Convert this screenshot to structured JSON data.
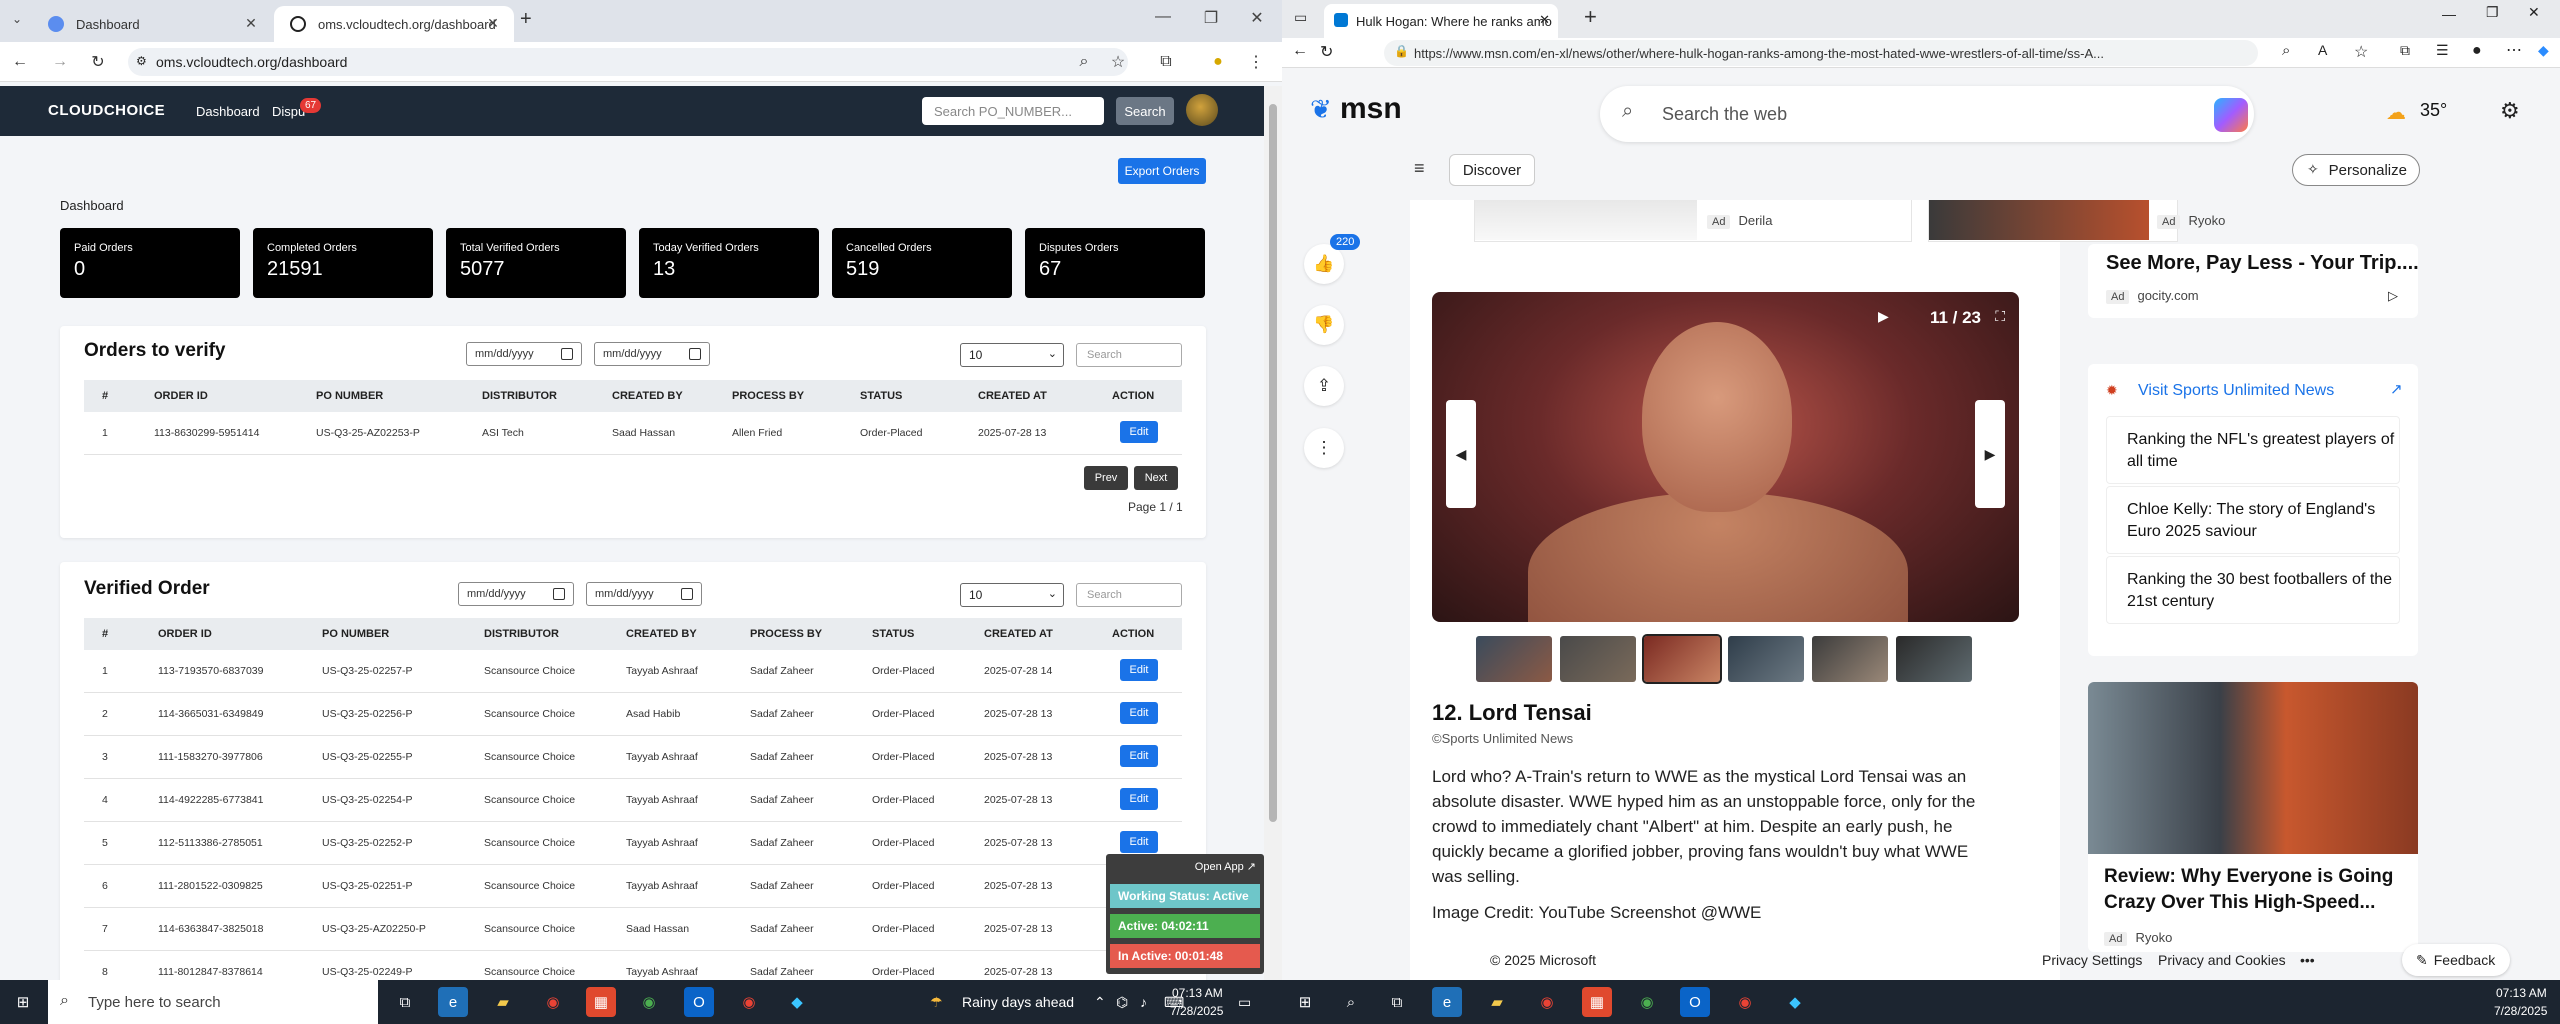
{
  "left_browser": {
    "tabs": [
      {
        "title": "Dashboard"
      },
      {
        "title": "oms.vcloudtech.org/dashboard"
      }
    ],
    "new_tab": "+",
    "url": "oms.vcloudtech.org/dashboard"
  },
  "app": {
    "logo": "CLOUDCHOICE",
    "nav": {
      "dashboard": "Dashboard",
      "disputes": "Dispu",
      "disputes_badge": "67"
    },
    "search_placeholder": "Search PO_NUMBER...",
    "search_button": "Search",
    "export_button": "Export Orders",
    "section": "Dashboard",
    "stats": [
      {
        "label": "Paid Orders",
        "value": "0"
      },
      {
        "label": "Completed Orders",
        "value": "21591"
      },
      {
        "label": "Total Verified Orders",
        "value": "5077"
      },
      {
        "label": "Today Verified Orders",
        "value": "13"
      },
      {
        "label": "Cancelled Orders",
        "value": "519"
      },
      {
        "label": "Disputes Orders",
        "value": "67"
      }
    ],
    "orders_to_verify": {
      "title": "Orders to verify",
      "date_from": "mm/dd/yyyy",
      "date_to": "mm/dd/yyyy",
      "page_size": "10",
      "search_placeholder": "Search",
      "headers": [
        "#",
        "ORDER ID",
        "PO NUMBER",
        "DISTRIBUTOR",
        "CREATED BY",
        "PROCESS BY",
        "STATUS",
        "CREATED AT",
        "ACTION"
      ],
      "rows": [
        {
          "n": "1",
          "order_id": "113-8630299-5951414",
          "po": "US-Q3-25-AZ02253-P",
          "distributor": "ASI Tech",
          "created_by": "Saad Hassan",
          "process_by": "Allen Fried",
          "status": "Order-Placed",
          "created_at": "2025-07-28 13",
          "action": "Edit"
        }
      ],
      "prev": "Prev",
      "next": "Next",
      "page_info": "Page 1 / 1"
    },
    "verified_order": {
      "title": "Verified Order",
      "date_from": "mm/dd/yyyy",
      "date_to": "mm/dd/yyyy",
      "page_size": "10",
      "search_placeholder": "Search",
      "headers": [
        "#",
        "ORDER ID",
        "PO NUMBER",
        "DISTRIBUTOR",
        "CREATED BY",
        "PROCESS BY",
        "STATUS",
        "CREATED AT",
        "ACTION"
      ],
      "rows": [
        {
          "n": "1",
          "order_id": "113-7193570-6837039",
          "po": "US-Q3-25-02257-P",
          "distributor": "Scansource Choice",
          "created_by": "Tayyab Ashraaf",
          "process_by": "Sadaf Zaheer",
          "status": "Order-Placed",
          "created_at": "2025-07-28 14",
          "action": "Edit"
        },
        {
          "n": "2",
          "order_id": "114-3665031-6349849",
          "po": "US-Q3-25-02256-P",
          "distributor": "Scansource Choice",
          "created_by": "Asad Habib",
          "process_by": "Sadaf Zaheer",
          "status": "Order-Placed",
          "created_at": "2025-07-28 13",
          "action": "Edit"
        },
        {
          "n": "3",
          "order_id": "111-1583270-3977806",
          "po": "US-Q3-25-02255-P",
          "distributor": "Scansource Choice",
          "created_by": "Tayyab Ashraaf",
          "process_by": "Sadaf Zaheer",
          "status": "Order-Placed",
          "created_at": "2025-07-28 13",
          "action": "Edit"
        },
        {
          "n": "4",
          "order_id": "114-4922285-6773841",
          "po": "US-Q3-25-02254-P",
          "distributor": "Scansource Choice",
          "created_by": "Tayyab Ashraaf",
          "process_by": "Sadaf Zaheer",
          "status": "Order-Placed",
          "created_at": "2025-07-28 13",
          "action": "Edit"
        },
        {
          "n": "5",
          "order_id": "112-5113386-2785051",
          "po": "US-Q3-25-02252-P",
          "distributor": "Scansource Choice",
          "created_by": "Tayyab Ashraaf",
          "process_by": "Sadaf Zaheer",
          "status": "Order-Placed",
          "created_at": "2025-07-28 13",
          "action": "Edit"
        },
        {
          "n": "6",
          "order_id": "111-2801522-0309825",
          "po": "US-Q3-25-02251-P",
          "distributor": "Scansource Choice",
          "created_by": "Tayyab Ashraaf",
          "process_by": "Sadaf Zaheer",
          "status": "Order-Placed",
          "created_at": "2025-07-28 13",
          "action": ""
        },
        {
          "n": "7",
          "order_id": "114-6363847-3825018",
          "po": "US-Q3-25-AZ02250-P",
          "distributor": "Scansource Choice",
          "created_by": "Saad Hassan",
          "process_by": "Sadaf Zaheer",
          "status": "Order-Placed",
          "created_at": "2025-07-28 13",
          "action": ""
        },
        {
          "n": "8",
          "order_id": "111-8012847-8378614",
          "po": "US-Q3-25-02249-P",
          "distributor": "Scansource Choice",
          "created_by": "Tayyab Ashraaf",
          "process_by": "Sadaf Zaheer",
          "status": "Order-Placed",
          "created_at": "2025-07-28 13",
          "action": ""
        }
      ]
    },
    "widget": {
      "open_app": "Open App ↗",
      "working_status": "Working Status: Active",
      "active": "Active: 04:02:11",
      "inactive": "In Active: 00:01:48"
    }
  },
  "right_browser": {
    "tab_title": "Hulk Hogan: Where he ranks amo",
    "new_tab": "+",
    "url": "https://www.msn.com/en-xl/news/other/where-hulk-hogan-ranks-among-the-most-hated-wwe-wrestlers-of-all-time/ss-A...",
    "msn_logo": "msn",
    "search_placeholder": "Search the web",
    "temperature": "35°",
    "discover": "Discover",
    "personalize": "Personalize",
    "top_ads": [
      {
        "tag": "Ad",
        "source": "Derila"
      },
      {
        "tag": "Ad",
        "source": "Ryoko"
      }
    ],
    "likes_count": "220",
    "slide_counter": "11 / 23",
    "article": {
      "title": "12. Lord Tensai",
      "source": "©Sports Unlimited News",
      "body": "Lord who? A-Train's return to WWE as the mystical Lord Tensai was an absolute disaster. WWE hyped him as an unstoppable force, only for the crowd to immediately chant \"Albert\" at him. Despite an early push, he quickly became a glorified jobber, proving fans wouldn't buy what WWE was selling.",
      "credit": "Image Credit: YouTube Screenshot @WWE"
    },
    "rail": {
      "ad1_title": "See More, Pay Less - Your Trip....",
      "ad1_tag": "Ad",
      "ad1_source": "gocity.com",
      "visit_link": "Visit Sports Unlimited News",
      "links": [
        "Ranking the NFL's greatest players of all time",
        "Chloe Kelly: The story of England's Euro 2025 saviour",
        "Ranking the 30 best footballers of the 21st century"
      ],
      "ad2_title": "Review: Why Everyone is Going Crazy Over This High-Speed...",
      "ad2_tag": "Ad",
      "ad2_source": "Ryoko"
    },
    "footer": {
      "copyright": "© 2025 Microsoft",
      "privacy_settings": "Privacy Settings",
      "privacy_cookies": "Privacy and Cookies",
      "more": "•••",
      "feedback": "Feedback"
    }
  },
  "taskbar": {
    "search_placeholder": "Type here to search",
    "weather": "Rainy days ahead",
    "left_clock_time": "07:13 AM",
    "left_clock_date": "7/28/2025",
    "right_clock_time": "07:13 AM",
    "right_clock_date": "7/28/2025"
  }
}
